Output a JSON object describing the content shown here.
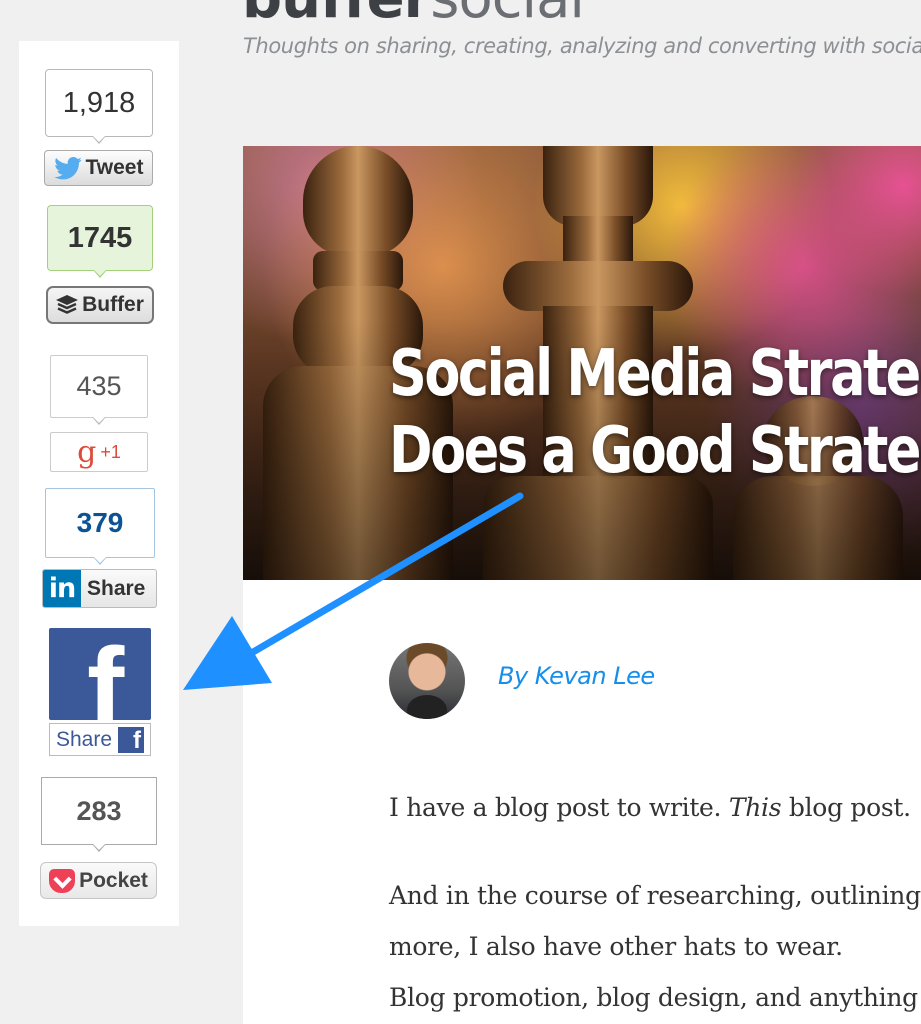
{
  "header": {
    "brand_bold": "buffer",
    "brand_light": "social",
    "tagline": "Thoughts on sharing, creating, analyzing and converting with social"
  },
  "share_bar": {
    "twitter": {
      "count": "1,918",
      "label": "Tweet"
    },
    "buffer": {
      "count": "1745",
      "label": "Buffer"
    },
    "google_plus": {
      "count": "435",
      "label_g": "g",
      "label_plus": "+1"
    },
    "linkedin": {
      "count": "379",
      "logo": "in",
      "label": "Share"
    },
    "facebook": {
      "logo": "f",
      "label": "Share",
      "small_logo": "f"
    },
    "pocket": {
      "count": "283",
      "label": "Pocket"
    }
  },
  "article": {
    "title_line1": "Social Media Strategy:",
    "title_line2": "Does a Good Strategy",
    "author": "By Kevan Lee",
    "paragraph1_a": "I have a blog post to write. ",
    "paragraph1_em": "This",
    "paragraph1_b": " blog post.",
    "paragraph2_line1": "And in the course of researching, outlining",
    "paragraph2_line2": "more, I also have other hats to wear.",
    "paragraph2_line3": "Blog promotion, blog design, and anything"
  },
  "colors": {
    "accent_blue": "#168eea",
    "arrow": "#1e90ff",
    "facebook": "#3b5998",
    "linkedin": "#0077b5",
    "pocket": "#ee4056",
    "twitter": "#55acee",
    "google_red": "#dd4b39"
  },
  "icons": [
    "twitter-bird-icon",
    "buffer-stack-icon",
    "linkedin-icon",
    "facebook-icon",
    "pocket-icon",
    "callout-arrow-icon"
  ]
}
